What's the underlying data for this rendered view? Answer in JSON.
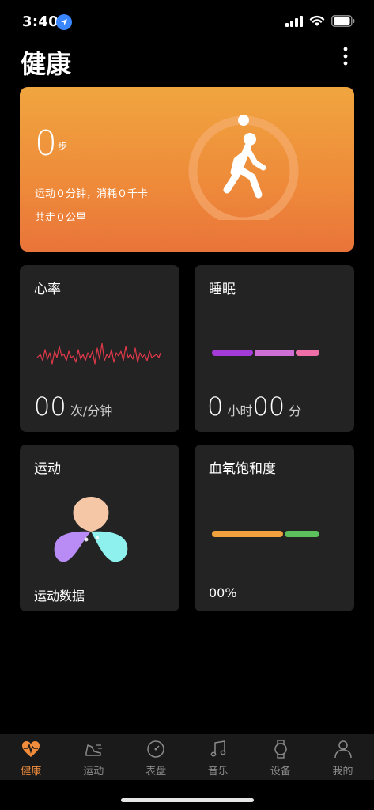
{
  "status": {
    "time": "3:40"
  },
  "header": {
    "title": "健康"
  },
  "steps": {
    "value": "0",
    "unit": "步",
    "line1": "运动０分钟，消耗０千卡",
    "line2": "共走０公里"
  },
  "heart": {
    "title": "心率",
    "value": "00",
    "unit": "次/分钟"
  },
  "sleep": {
    "title": "睡眠",
    "hours": "0",
    "hours_unit": "小时",
    "minutes": "00",
    "minutes_unit": "分"
  },
  "exercise": {
    "title": "运动",
    "caption": "运动数据"
  },
  "spo2": {
    "title": "血氧饱和度",
    "value": "00%"
  },
  "tabs": [
    {
      "label": "健康",
      "icon": "heart-pulse-icon",
      "active": true
    },
    {
      "label": "运动",
      "icon": "shoe-icon"
    },
    {
      "label": "表盘",
      "icon": "watch-face-icon"
    },
    {
      "label": "音乐",
      "icon": "music-note-icon"
    },
    {
      "label": "设备",
      "icon": "watch-device-icon"
    },
    {
      "label": "我的",
      "icon": "person-icon"
    }
  ],
  "colors": {
    "accent": "#f08c3c",
    "card_orange": "#ee8a3a",
    "tile_bg": "#232323",
    "tab_bg": "#1a1a1a"
  }
}
